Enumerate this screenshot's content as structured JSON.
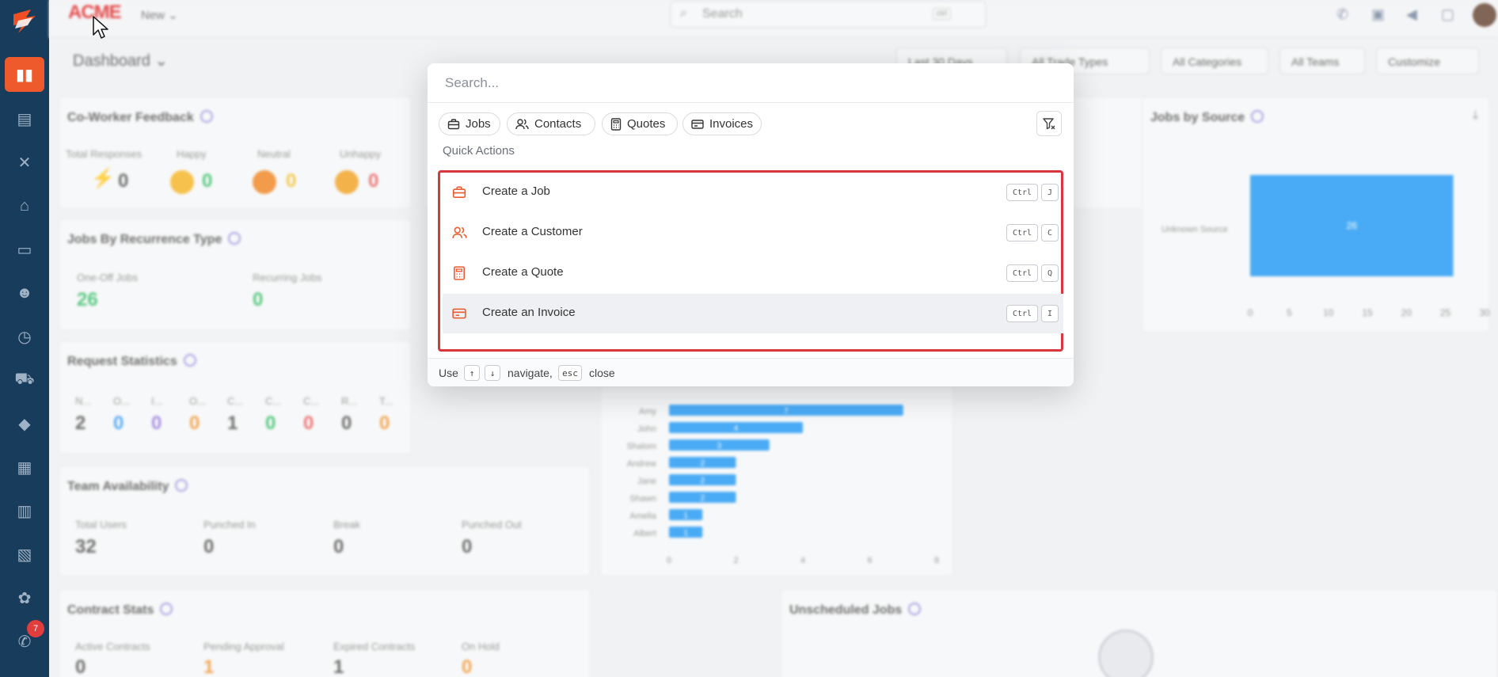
{
  "app": {
    "brand": "ACME",
    "new_label": "New",
    "search_placeholder": "Search",
    "search_shortcut": "ctrl",
    "dashboard_title": "Dashboard",
    "notification_badge": "7",
    "filters": [
      "Last 30 Days",
      "All Trade Types",
      "All Categories",
      "All Teams",
      "Customize"
    ]
  },
  "cards": {
    "coworker": {
      "title": "Co-Worker Feedback",
      "labels": [
        "Total Responses",
        "Happy",
        "Neutral",
        "Unhappy"
      ],
      "values": [
        "0",
        "0",
        "0",
        "0"
      ]
    },
    "recurrence": {
      "title": "Jobs By Recurrence Type",
      "labels": [
        "One-Off Jobs",
        "Recurring Jobs"
      ],
      "values": [
        "26",
        "0"
      ]
    },
    "requests": {
      "title": "Request Statistics",
      "labels": [
        "N...",
        "O...",
        "I...",
        "O...",
        "C...",
        "C...",
        "C...",
        "R...",
        "T..."
      ],
      "values": [
        "2",
        "0",
        "0",
        "0",
        "1",
        "0",
        "0",
        "0",
        "0"
      ]
    },
    "team": {
      "title": "Team Availability",
      "labels": [
        "Total Users",
        "Punched In",
        "Break",
        "Punched Out"
      ],
      "values": [
        "32",
        "0",
        "0",
        "0"
      ]
    },
    "contracts": {
      "title": "Contract Stats",
      "labels": [
        "Active Contracts",
        "Pending Approval",
        "Expired Contracts",
        "On Hold"
      ],
      "values": [
        "0",
        "1",
        "1",
        "0"
      ]
    },
    "jobs_by_source": {
      "title": "Jobs by Source",
      "category": "Unknown Source",
      "value": "26",
      "ticks": [
        "0",
        "5",
        "10",
        "15",
        "20",
        "25",
        "30"
      ]
    },
    "unscheduled": {
      "title": "Unscheduled Jobs"
    },
    "tech_chart": {
      "names": [
        "Amy",
        "John",
        "Shalom",
        "Andrew",
        "Jane",
        "Shawn",
        "Amelia",
        "Albert"
      ],
      "values": [
        "7",
        "4",
        "3",
        "2",
        "2",
        "2",
        "1",
        "1"
      ],
      "ticks": [
        "0",
        "2",
        "4",
        "6",
        "8"
      ]
    }
  },
  "modal": {
    "search_placeholder": "Search...",
    "chips": [
      {
        "label": "Jobs",
        "icon": "briefcase-icon"
      },
      {
        "label": "Contacts",
        "icon": "users-icon"
      },
      {
        "label": "Quotes",
        "icon": "calculator-icon"
      },
      {
        "label": "Invoices",
        "icon": "card-icon"
      }
    ],
    "quick_actions_title": "Quick Actions",
    "actions": [
      {
        "label": "Create a Job",
        "mod": "Ctrl",
        "key": "J",
        "icon": "briefcase-icon"
      },
      {
        "label": "Create a Customer",
        "mod": "Ctrl",
        "key": "C",
        "icon": "users-icon"
      },
      {
        "label": "Create a Quote",
        "mod": "Ctrl",
        "key": "Q",
        "icon": "calculator-icon"
      },
      {
        "label": "Create an Invoice",
        "mod": "Ctrl",
        "key": "I",
        "icon": "card-icon"
      }
    ],
    "footer": {
      "use": "Use",
      "up": "↑",
      "down": "↓",
      "navigate": "navigate,",
      "esc": "esc",
      "close": "close"
    }
  },
  "colors": {
    "accent": "#ee5a2c",
    "sidebar": "#183c5c",
    "highlight_border": "#d9363e",
    "bar": "#2a9df4"
  }
}
